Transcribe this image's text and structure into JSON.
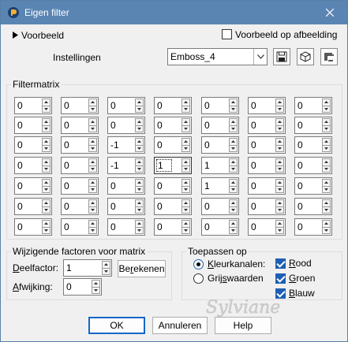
{
  "window": {
    "title": "Eigen filter"
  },
  "top": {
    "preview_toggle_label": "Voorbeeld",
    "preview_on_image_label": "Voorbeeld op afbeelding",
    "preview_on_image_checked": false,
    "settings_label": "Instellingen",
    "preset_value": "Emboss_4"
  },
  "matrix": {
    "title": "Filtermatrix",
    "rows": [
      [
        "0",
        "0",
        "0",
        "0",
        "0",
        "0",
        "0"
      ],
      [
        "0",
        "0",
        "0",
        "0",
        "0",
        "0",
        "0"
      ],
      [
        "0",
        "0",
        "-1",
        "0",
        "0",
        "0",
        "0"
      ],
      [
        "0",
        "0",
        "-1",
        "1",
        "1",
        "0",
        "0"
      ],
      [
        "0",
        "0",
        "0",
        "0",
        "1",
        "0",
        "0"
      ],
      [
        "0",
        "0",
        "0",
        "0",
        "0",
        "0",
        "0"
      ],
      [
        "0",
        "0",
        "0",
        "0",
        "0",
        "0",
        "0"
      ]
    ]
  },
  "factors": {
    "title": "Wijzigende factoren voor matrix",
    "divisor_label": "Deelfactor:",
    "divisor_value": "1",
    "calculate_label": "Berekenen",
    "bias_label": "Afwijking:",
    "bias_value": "0"
  },
  "apply": {
    "title": "Toepassen op",
    "color_channels_label": "Kleurkanalen:",
    "grayscale_label": "Grijswaarden",
    "red_label": "Rood",
    "green_label": "Groen",
    "blue_label": "Blauw"
  },
  "buttons": {
    "ok": "OK",
    "cancel": "Annuleren",
    "help": "Help"
  },
  "watermark": "Sylviane",
  "colors": {
    "titlebar": "#5a85b3",
    "accent": "#1e5fb4"
  }
}
